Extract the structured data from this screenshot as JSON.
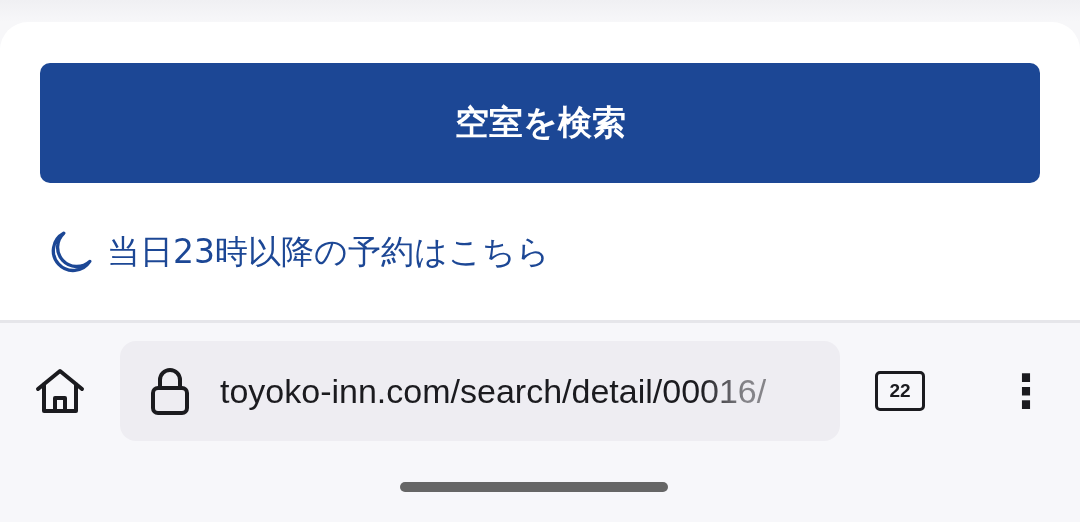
{
  "page": {
    "search_button": "空室を検索",
    "late_link": "当日23時以降の予約はこちら"
  },
  "browser_bar": {
    "url": "toyoko-inn.com/search/detail/00016/",
    "tab_count": "22",
    "menu": "⋮"
  }
}
